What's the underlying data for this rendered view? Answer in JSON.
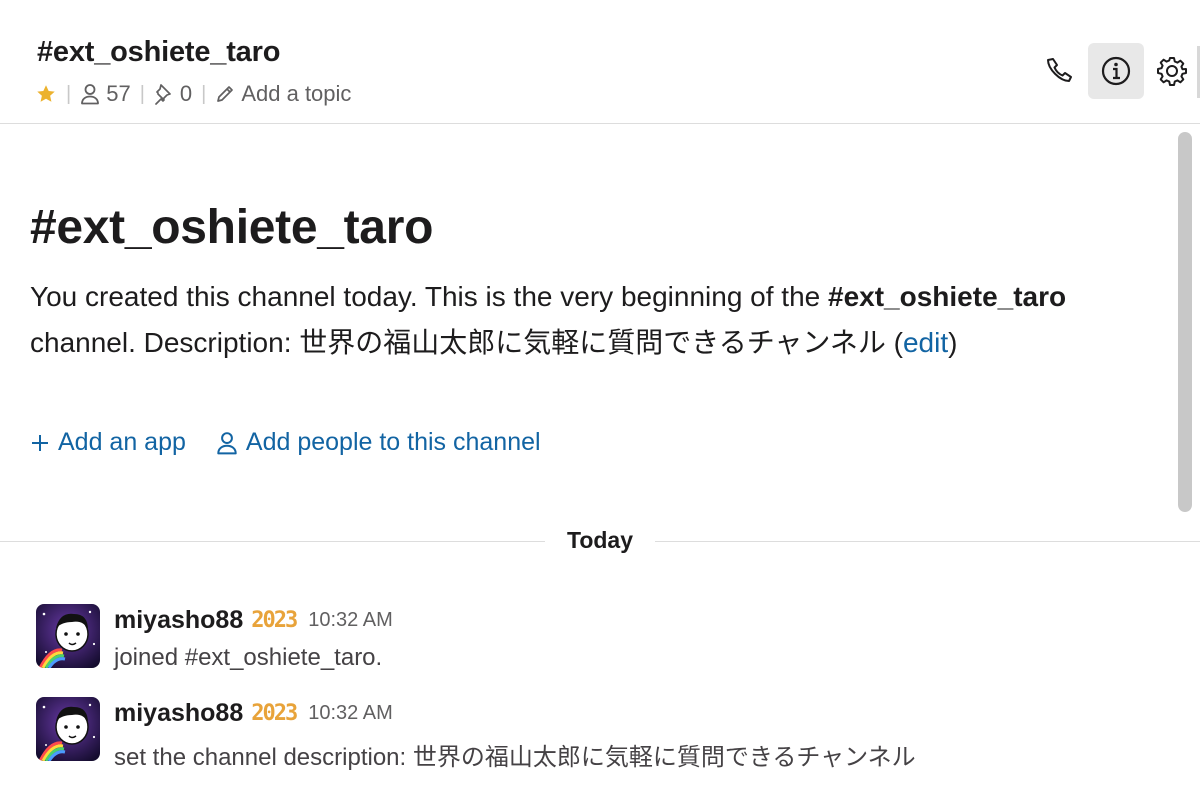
{
  "header": {
    "channel_name": "#ext_oshiete_taro",
    "member_count": "57",
    "pinned_count": "0",
    "add_topic": "Add a topic",
    "icons": [
      "star-icon",
      "person-icon",
      "pin-icon",
      "pencil-icon",
      "phone-icon",
      "info-icon",
      "gear-icon"
    ]
  },
  "intro": {
    "title": "#ext_oshiete_taro",
    "line1": "You created this channel today. This is the very beginning of the ",
    "channel_ref": "#ext_oshiete_taro",
    "line2": " channel. Description: 世界の福山太郎に気軽に質問できるチャンネル (",
    "edit_link": "edit",
    "close_paren": ")",
    "add_app": "Add an app",
    "add_people": "Add people to this channel"
  },
  "divider": {
    "label": "Today"
  },
  "messages": [
    {
      "author": "miyasho88",
      "badge": "2023",
      "time": "10:32 AM",
      "text": "joined #ext_oshiete_taro."
    },
    {
      "author": "miyasho88",
      "badge": "2023",
      "time": "10:32 AM",
      "text": "set the channel description: 世界の福山太郎に気軽に質問できるチャンネル"
    }
  ],
  "colors": {
    "link": "#1264a3",
    "star": "#ecb22e",
    "badge": "#e8a33a",
    "active_button": "#e8e8e8"
  }
}
